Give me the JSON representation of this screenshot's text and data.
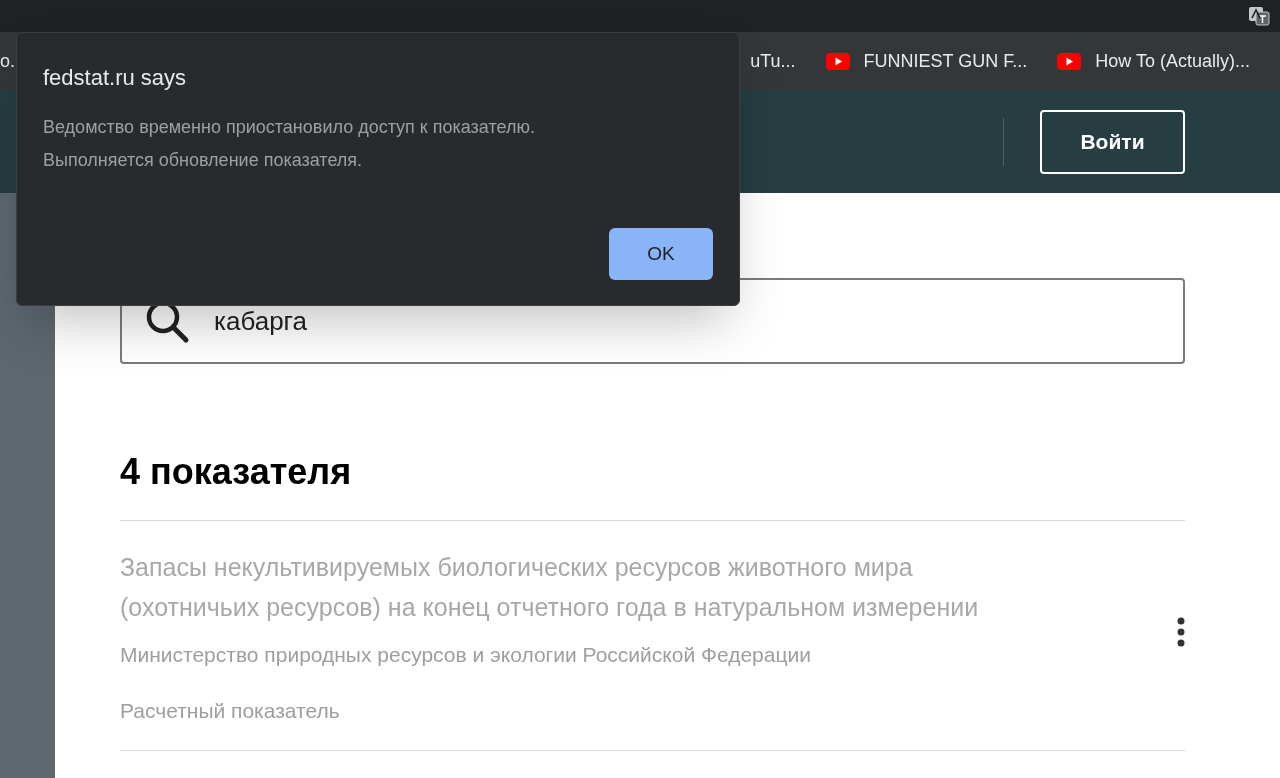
{
  "bookmarks": [
    {
      "label": "o.",
      "kind": "plain"
    },
    {
      "label": "uTu...",
      "kind": "plain"
    },
    {
      "label": "FUNNIEST GUN F...",
      "kind": "youtube"
    },
    {
      "label": "How To (Actually)...",
      "kind": "youtube"
    }
  ],
  "header": {
    "login_button": "Войти"
  },
  "search": {
    "value": "кабарга"
  },
  "results": {
    "heading": "4 показателя",
    "items": [
      {
        "title": "Запасы некультивируемых биологических ресурсов животного мира (охотничьих ресурсов) на конец отчетного года в натуральном измерении",
        "agency": "Министерство природных ресурсов и экологии Российской Федерации",
        "type": "Расчетный показатель"
      }
    ]
  },
  "dialog": {
    "title": "fedstat.ru says",
    "message": [
      "Ведомство временно приостановило доступ к показателю.",
      "Выполняется обновление показателя."
    ],
    "ok_button": "OK"
  }
}
